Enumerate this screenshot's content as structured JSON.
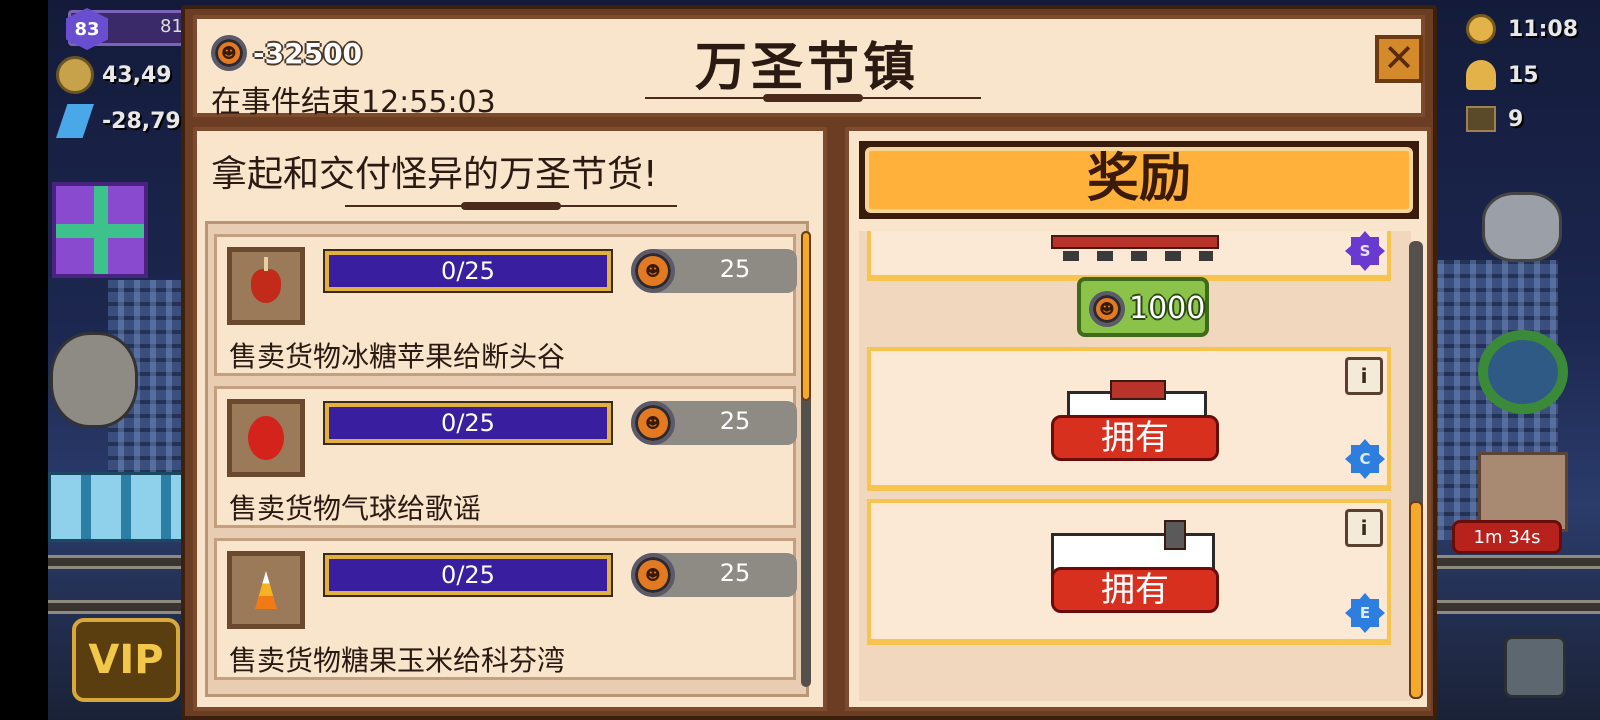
{
  "hud": {
    "level": "83",
    "level_progress_text": "81",
    "coins": "43,49",
    "gems": "-28,79",
    "clock_time": "11:08",
    "workers": "15",
    "crates": "9",
    "offer_timer": "1m 34s",
    "vip_label": "VIP"
  },
  "dialog": {
    "currency_amount": "-32500",
    "event_timer": "在事件结束12:55:03",
    "title": "万圣节镇",
    "close_glyph": "✕"
  },
  "tasks": {
    "heading": "拿起和交付怪异的万圣节货!",
    "items": [
      {
        "progress": "0/25",
        "progress_fraction": 0,
        "reward": "25",
        "label": "售卖货物冰糖苹果给断头谷",
        "item_icon": "candy-apple-icon"
      },
      {
        "progress": "0/25",
        "progress_fraction": 0,
        "reward": "25",
        "label": "售卖货物气球给歌谣",
        "item_icon": "balloon-icon"
      },
      {
        "progress": "0/25",
        "progress_fraction": 0,
        "reward": "25",
        "label": "售卖货物糖果玉米给科芬湾",
        "item_icon": "candy-corn-icon"
      }
    ]
  },
  "rewards": {
    "heading": "奖励",
    "cards": [
      {
        "item_icon": "flatcar-icon",
        "class_badge": "S",
        "price": "1000"
      },
      {
        "item_icon": "candle-car-icon",
        "class_badge": "C",
        "status": "拥有"
      },
      {
        "item_icon": "candle-locomotive-icon",
        "class_badge": "E",
        "status": "拥有"
      }
    ]
  },
  "colors": {
    "accent_orange": "#ffb13c",
    "progress_purple": "#3a1ea0",
    "owned_red": "#d8301e",
    "price_green": "#8ac24a",
    "panel_cream": "#f9e4cc"
  }
}
